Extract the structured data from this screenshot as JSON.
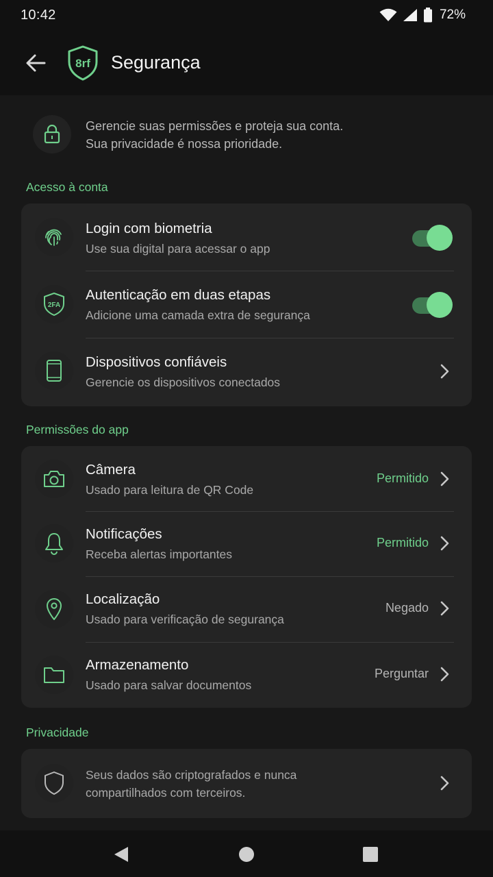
{
  "status_bar": {
    "time": "10:42",
    "battery": "72%"
  },
  "app_bar": {
    "title": "Segurança",
    "logo_text": "8rf"
  },
  "intro": {
    "line1": "Gerencie suas permissões e proteja sua conta.",
    "line2": "Sua privacidade é nossa prioridade."
  },
  "sections": {
    "account": {
      "title": "Acesso à conta",
      "items": [
        {
          "title": "Login com biometria",
          "subtitle": "Use sua digital para acessar o app",
          "enabled": true
        },
        {
          "title": "Autenticação em duas etapas",
          "subtitle": "Adicione uma camada extra de segurança",
          "enabled": true,
          "icon_text": "2FA"
        },
        {
          "title": "Dispositivos confiáveis",
          "subtitle": "Gerencie os dispositivos conectados"
        }
      ]
    },
    "permissions": {
      "title": "Permissões do app",
      "items": [
        {
          "title": "Câmera",
          "subtitle": "Usado para leitura de QR Code",
          "status": "Permitido"
        },
        {
          "title": "Notificações",
          "subtitle": "Receba alertas importantes",
          "status": "Permitido"
        },
        {
          "title": "Localização",
          "subtitle": "Usado para verificação de segurança",
          "status": "Negado"
        },
        {
          "title": "Armazenamento",
          "subtitle": "Usado para salvar documentos",
          "status": "Perguntar"
        }
      ]
    },
    "privacy": {
      "title": "Privacidade",
      "line1": "Seus dados são criptografados e nunca",
      "line2": "compartilhados com terceiros."
    }
  },
  "colors": {
    "accent": "#6fd08c",
    "background": "#181818",
    "card": "#242424",
    "bars": "#111111"
  },
  "icons": {
    "intro": "lock-icon",
    "biometric": "fingerprint-icon",
    "two_factor": "shield-2fa-icon",
    "devices": "phone-icon",
    "camera": "camera-icon",
    "notifications": "bell-icon",
    "location": "location-pin-icon",
    "storage": "folder-icon",
    "privacy": "shield-icon"
  }
}
